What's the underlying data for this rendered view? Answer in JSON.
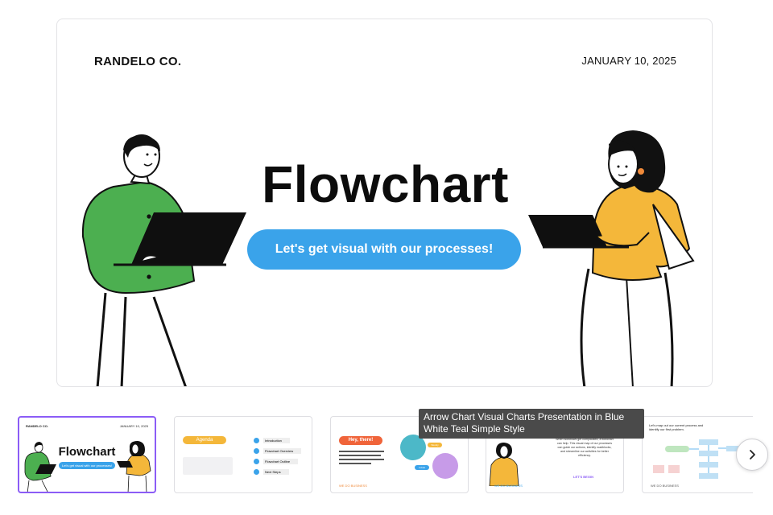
{
  "slide": {
    "brand": "RANDELO CO.",
    "date": "JANUARY 10, 2025",
    "title": "Flowchart",
    "subtitle": "Let's get visual with our processes!"
  },
  "thumbnails": [
    {
      "brand": "RANDELO CO.",
      "date": "JANUARY 10, 2025",
      "title": "Flowchart",
      "subtitle": "Let's get visual with our processes!",
      "selected": true
    },
    {
      "heading": "Agenda",
      "items": [
        "Introduction",
        "Flowchart Overview",
        "Flowchart Outline",
        "Next Steps"
      ]
    },
    {
      "heading": "Hey, there!",
      "name_a": "Wendy",
      "name_b": "Lukas",
      "footer": "WE DO BUSINESS"
    },
    {
      "heading": "",
      "body": "When workflows get complicated, a flowchart can help. This visual map of our processes can guide our actions, identify roadblocks, and streamline our activities for better efficiency.",
      "cta": "LET'S BEGIN",
      "footer": "WE DO BUSINESS"
    },
    {
      "caption": "Let's map out our current process and identify our first problem.",
      "footer": "WE DO BUSINESS"
    }
  ],
  "tooltip": "Arrow Chart Visual Charts Presentation in Blue White Teal Simple Style",
  "next_icon": "chevron-right-icon",
  "colors": {
    "accent_blue": "#3aa3ea",
    "selected_border": "#8b5cf6",
    "green_shirt": "#4caf50",
    "yellow_shirt": "#f4b73a",
    "orange": "#f08a3a"
  }
}
